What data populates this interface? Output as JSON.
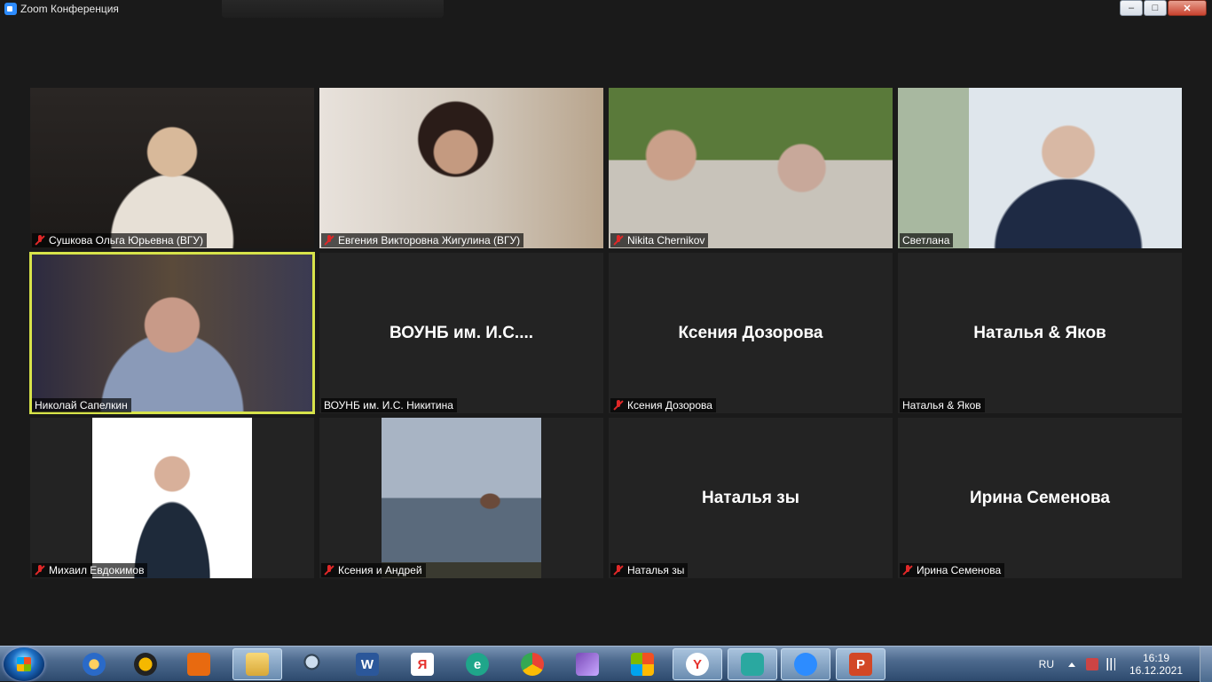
{
  "window": {
    "title": "Zoom Конференция",
    "controls": [
      "minimize",
      "maximize",
      "close"
    ]
  },
  "participants": [
    {
      "name": "Сушкова Ольга Юрьевна (ВГУ)",
      "video": true,
      "muted": true
    },
    {
      "name": "Евгения Викторовна Жигулина (ВГУ)",
      "video": true,
      "muted": true
    },
    {
      "name": "Nikita Chernikov",
      "video": true,
      "muted": true
    },
    {
      "name": "Светлана",
      "video": true,
      "muted": false
    },
    {
      "name": "Николай Сапелкин",
      "video": true,
      "muted": false,
      "speaking": true
    },
    {
      "name": "ВОУНБ им. И.С. Никитина",
      "display": "ВОУНБ им. И.С....",
      "video": false,
      "muted": false
    },
    {
      "name": "Ксения Дозорова",
      "display": "Ксения Дозорова",
      "video": false,
      "muted": true
    },
    {
      "name": "Наталья & Яков",
      "display": "Наталья & Яков",
      "video": false,
      "muted": false
    },
    {
      "name": "Михаил Евдокимов",
      "video": true,
      "muted": true
    },
    {
      "name": "Ксения и Андрей",
      "video": true,
      "muted": true
    },
    {
      "name": "Наталья зы",
      "display": "Наталья зы",
      "video": false,
      "muted": true
    },
    {
      "name": "Ирина Семенова",
      "display": "Ирина Семенова",
      "video": false,
      "muted": true
    }
  ],
  "taskbar": {
    "apps": [
      {
        "icon": "aimp-icon"
      },
      {
        "icon": "ie-icon"
      },
      {
        "icon": "daemon-tools-icon"
      },
      {
        "icon": "media-player-icon"
      },
      {
        "icon": "file-explorer-icon",
        "active": true
      },
      {
        "icon": "search-magnifier-icon"
      },
      {
        "icon": "word-icon",
        "label": "W"
      },
      {
        "icon": "yandex-browser-icon",
        "label": "Я"
      },
      {
        "icon": "edge-icon",
        "label": "e"
      },
      {
        "icon": "chrome-icon"
      },
      {
        "icon": "visual-studio-icon"
      },
      {
        "icon": "paint-icon"
      },
      {
        "icon": "yandex-icon",
        "label": "Y"
      },
      {
        "icon": "screenshot-tool-icon"
      },
      {
        "icon": "zoom-icon",
        "active": true
      },
      {
        "icon": "powerpoint-icon",
        "label": "P"
      }
    ],
    "language": "RU",
    "time": "16:19",
    "date": "16.12.2021"
  },
  "colors": {
    "speaking_border": "#d7e34a",
    "muted_icon": "#e02828",
    "tile_bg": "#232323"
  }
}
